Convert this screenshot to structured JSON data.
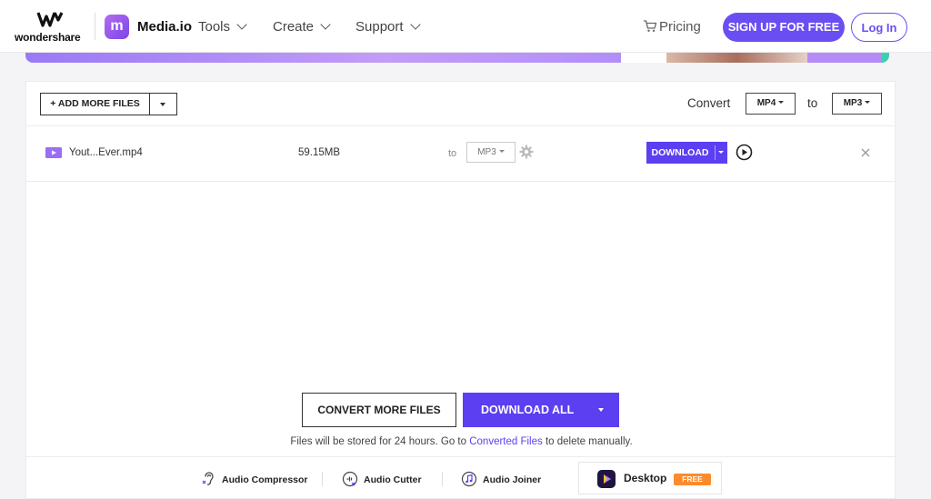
{
  "header": {
    "brand_name": "wondershare",
    "app_badge": "m",
    "app_name": "Media.io",
    "nav": [
      "Tools",
      "Create",
      "Support"
    ],
    "pricing": "Pricing",
    "signup": "SIGN UP FOR FREE",
    "login": "Log In"
  },
  "toolbar": {
    "add_files": "+ ADD MORE FILES",
    "convert_label": "Convert",
    "from_format": "MP4",
    "to_label": "to",
    "to_format": "MP3"
  },
  "file": {
    "name": "Yout...Ever.mp4",
    "size": "59.15MB",
    "to_label": "to",
    "format": "MP3",
    "download": "DOWNLOAD"
  },
  "actions": {
    "convert_more": "CONVERT MORE FILES",
    "download_all": "DOWNLOAD ALL"
  },
  "notice": {
    "prefix": "Files will be stored for 24 hours. Go to ",
    "link": "Converted Files",
    "suffix": " to delete manually."
  },
  "tools": {
    "compressor": "Audio Compressor",
    "cutter": "Audio Cutter",
    "joiner": "Audio Joiner",
    "desktop": "Desktop",
    "free": "FREE"
  },
  "colors": {
    "accent": "#5b3ff0",
    "signup": "#6b4ef2",
    "free_badge": "#ff8a2a"
  }
}
